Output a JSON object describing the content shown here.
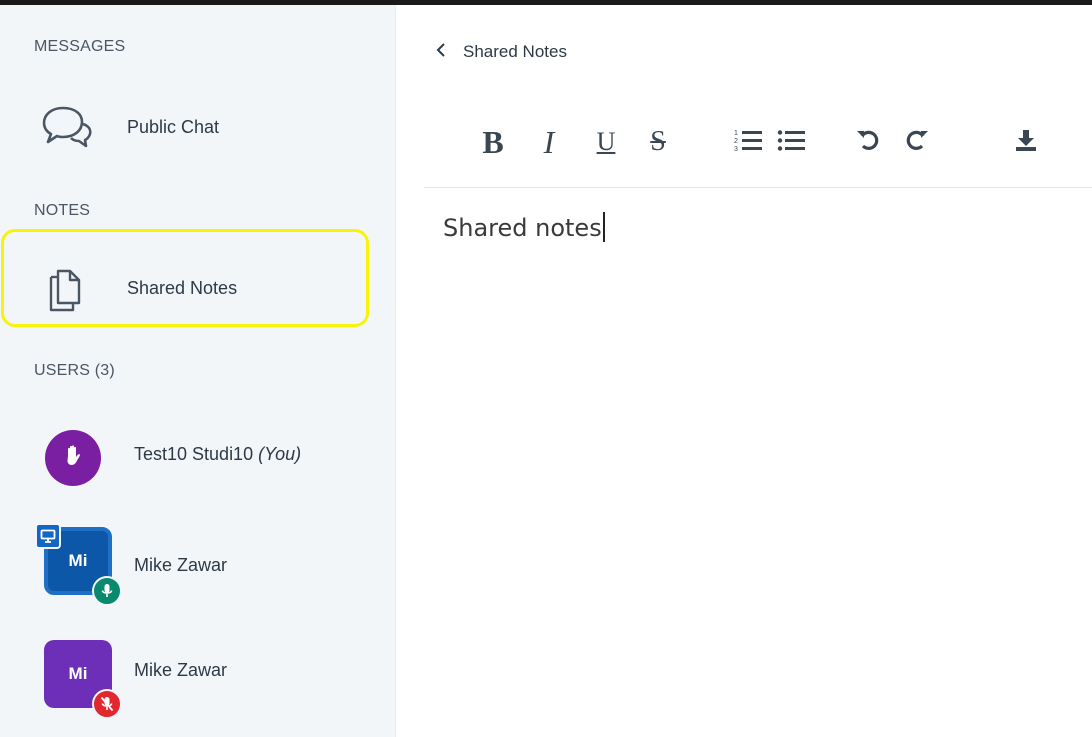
{
  "sidebar": {
    "messages_title": "MESSAGES",
    "public_chat_label": "Public Chat",
    "notes_title": "NOTES",
    "shared_notes_label": "Shared Notes",
    "users_title": "USERS (3)",
    "users": [
      {
        "name": "Test10 Studi10",
        "you_tag": "(You)",
        "avatar": "",
        "status": "raise-hand",
        "color": "#7b1fa2"
      },
      {
        "name": "Mike Zawar",
        "avatar": "Mi",
        "status": "presenter-mic-on",
        "color": "#0c57a7"
      },
      {
        "name": "Mike Zawar",
        "avatar": "Mi",
        "status": "mic-muted",
        "color": "#6d2fb8"
      }
    ]
  },
  "notes_panel": {
    "back_label": "Shared Notes",
    "toolbar": {
      "bold": "B",
      "italic": "I",
      "underline": "U",
      "strikethrough": "S",
      "icons": [
        "ordered-list-icon",
        "unordered-list-icon",
        "undo-icon",
        "redo-icon",
        "download-icon"
      ]
    },
    "content": "Shared notes"
  },
  "highlight_color": "#f7f30a"
}
